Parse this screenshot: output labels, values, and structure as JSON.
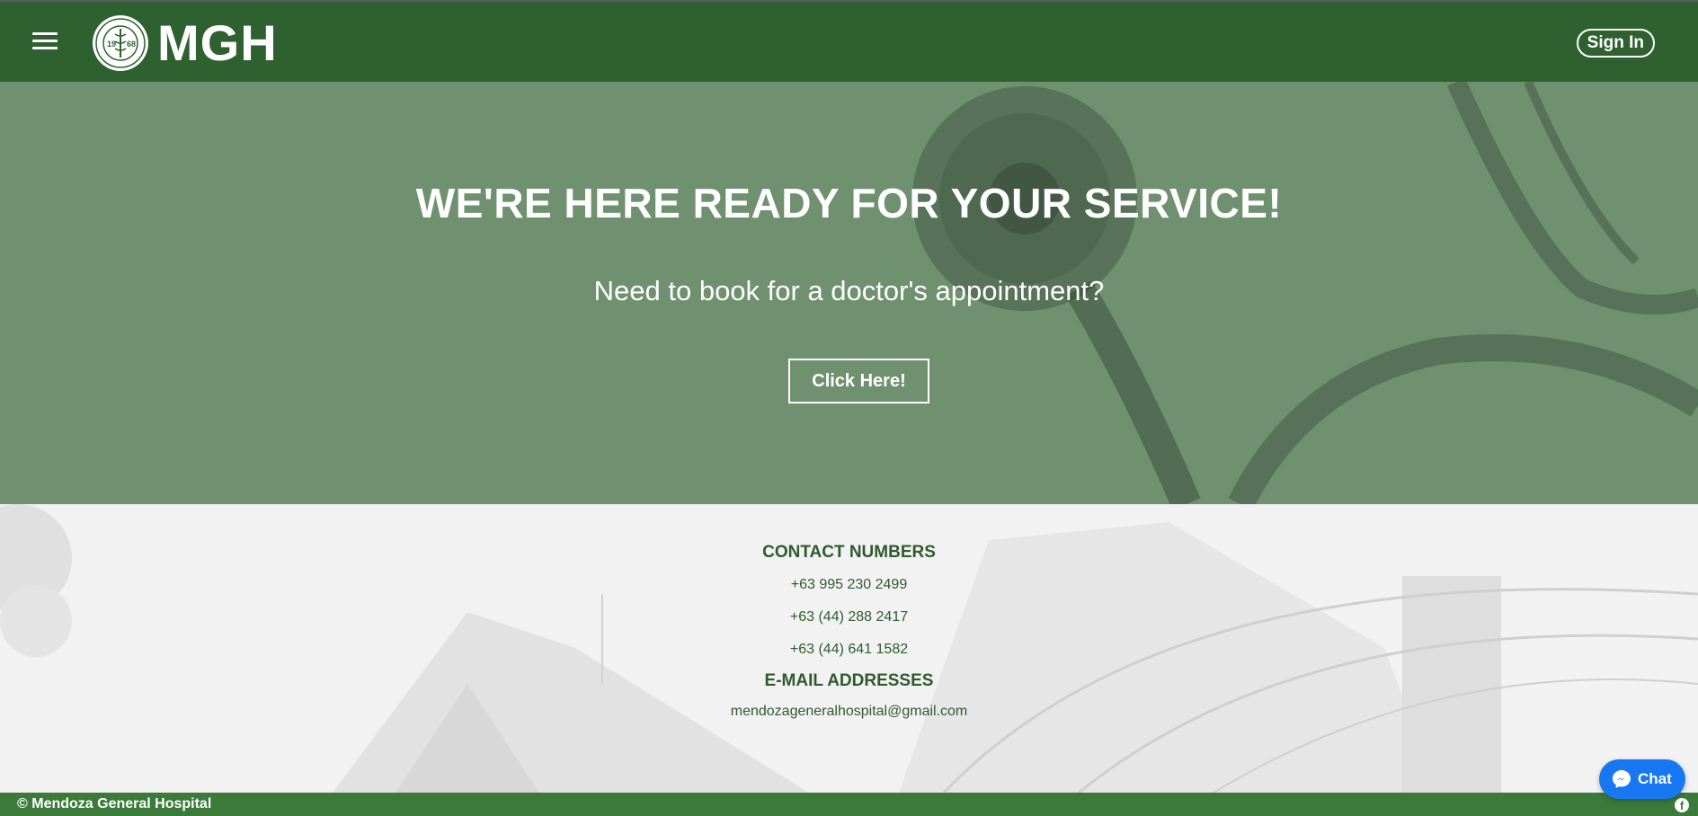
{
  "header": {
    "brand": "MGH",
    "logo_seal_text": "MENDOZA GENERAL HOSPITAL · SANTA MARIA, BULACAN · 1968",
    "signin_label": "Sign In"
  },
  "hero": {
    "title": "WE'RE HERE READY FOR YOUR SERVICE!",
    "subtitle": "Need to book for a doctor's appointment?",
    "button_label": "Click Here!"
  },
  "contact": {
    "numbers_heading": "CONTACT NUMBERS",
    "numbers": [
      "+63 995 230 2499",
      "+63 (44) 288 2417",
      "+63 (44) 641 1582"
    ],
    "email_heading": "E-MAIL ADDRESSES",
    "emails": [
      "mendozageneralhospital@gmail.com"
    ]
  },
  "footer": {
    "copyright": "© Mendoza General Hospital"
  },
  "chat": {
    "label": "Chat"
  },
  "colors": {
    "header_green": "#2f6130",
    "hero_overlay": "#6d8f6d",
    "footer_green": "#3b7a3b",
    "text_green": "#2f5a2f",
    "messenger_blue": "#1877f2"
  },
  "icons": {
    "menu": "hamburger-icon",
    "facebook": "facebook-icon",
    "messenger": "messenger-icon"
  }
}
